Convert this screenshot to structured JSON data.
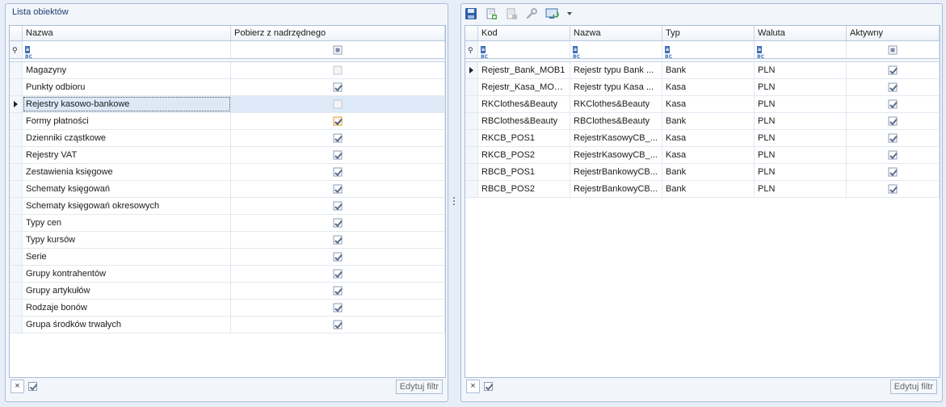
{
  "left": {
    "title": "Lista obiektów",
    "columns": [
      "Nazwa",
      "Pobierz z nadrzędnego"
    ],
    "filter_icon": "abc-filter-icon",
    "rows": [
      {
        "name": "Magazyny",
        "checked": false,
        "disabled": true
      },
      {
        "name": "Punkty odbioru",
        "checked": true
      },
      {
        "name": "Rejestry kasowo-bankowe",
        "checked": false,
        "disabled": true,
        "selected": true
      },
      {
        "name": "Formy płatności",
        "checked": true,
        "highlight": true
      },
      {
        "name": "Dzienniki cząstkowe",
        "checked": true
      },
      {
        "name": "Rejestry VAT",
        "checked": true
      },
      {
        "name": "Zestawienia księgowe",
        "checked": true
      },
      {
        "name": "Schematy księgowań",
        "checked": true
      },
      {
        "name": "Schematy księgowań okresowych",
        "checked": true
      },
      {
        "name": "Typy cen",
        "checked": true
      },
      {
        "name": "Typy kursów",
        "checked": true
      },
      {
        "name": "Serie",
        "checked": true
      },
      {
        "name": "Grupy kontrahentów",
        "checked": true
      },
      {
        "name": "Grupy artykułów",
        "checked": true
      },
      {
        "name": "Rodzaje bonów",
        "checked": true
      },
      {
        "name": "Grupa środków trwałych",
        "checked": true
      }
    ],
    "footer": {
      "clear_label": "×",
      "edit_filter_label": "Edytuj filtr"
    }
  },
  "right": {
    "toolbar": [
      "save-icon",
      "add-icon",
      "delete-icon",
      "wrench-icon",
      "screen-refresh-icon",
      "dropdown-arrow-icon"
    ],
    "columns": [
      "Kod",
      "Nazwa",
      "Typ",
      "Waluta",
      "Aktywny"
    ],
    "rows": [
      {
        "kod": "Rejestr_Bank_MOB1",
        "nazwa": "Rejestr typu Bank ...",
        "typ": "Bank",
        "waluta": "PLN",
        "aktywny": true,
        "current": true
      },
      {
        "kod": "Rejestr_Kasa_MOB...",
        "nazwa": "Rejestr typu Kasa ...",
        "typ": "Kasa",
        "waluta": "PLN",
        "aktywny": true
      },
      {
        "kod": "RKClothes&Beauty",
        "nazwa": "RKClothes&Beauty",
        "typ": "Kasa",
        "waluta": "PLN",
        "aktywny": true
      },
      {
        "kod": "RBClothes&Beauty",
        "nazwa": "RBClothes&Beauty",
        "typ": "Bank",
        "waluta": "PLN",
        "aktywny": true
      },
      {
        "kod": "RKCB_POS1",
        "nazwa": "RejestrKasowyCB_...",
        "typ": "Kasa",
        "waluta": "PLN",
        "aktywny": true
      },
      {
        "kod": "RKCB_POS2",
        "nazwa": "RejestrKasowyCB_...",
        "typ": "Kasa",
        "waluta": "PLN",
        "aktywny": true
      },
      {
        "kod": "RBCB_POS1",
        "nazwa": "RejestrBankowyCB...",
        "typ": "Bank",
        "waluta": "PLN",
        "aktywny": true
      },
      {
        "kod": "RBCB_POS2",
        "nazwa": "RejestrBankowyCB...",
        "typ": "Bank",
        "waluta": "PLN",
        "aktywny": true
      }
    ],
    "footer": {
      "clear_label": "×",
      "edit_filter_label": "Edytuj filtr"
    }
  }
}
